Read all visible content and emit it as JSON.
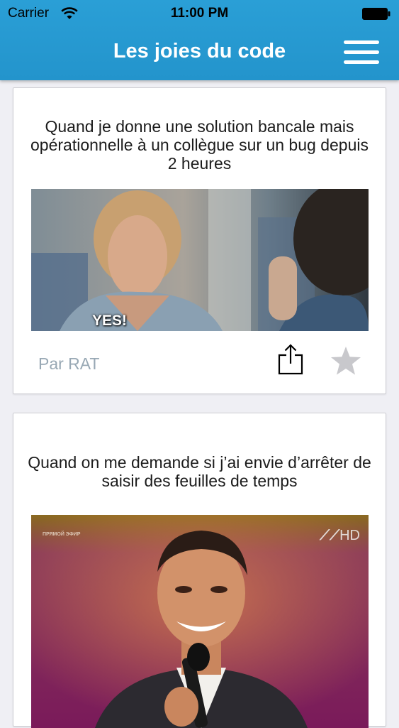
{
  "status_bar": {
    "carrier": "Carrier",
    "time": "11:00 PM"
  },
  "nav": {
    "title": "Les joies du code",
    "menu_icon": "hamburger-menu-icon",
    "color": "#2a9fd6"
  },
  "posts": [
    {
      "title": "Quand je donne une solution bancale mais opérationnelle à un collègue sur un bug depuis 2 heures",
      "image_caption": "YES!",
      "author": "Par RAT",
      "share_icon": "share-icon",
      "favorite_icon": "star-icon"
    },
    {
      "title": "Quand on me demande si j’ai envie d’arrêter de saisir des feuilles de temps",
      "image_overlay_left": "ПРЯМОЙ ЭФИР",
      "image_overlay_right": "HD"
    }
  ]
}
